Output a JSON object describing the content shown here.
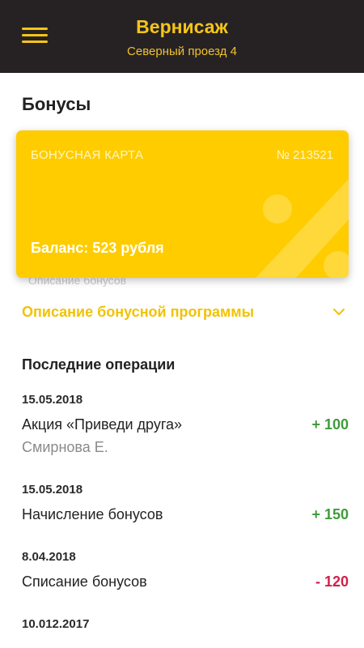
{
  "header": {
    "title": "Вернисаж",
    "subtitle": "Северный проезд 4",
    "icon": "menu-icon",
    "background_color": "#262224",
    "accent_color": "#f5c518"
  },
  "page": {
    "title": "Бонусы"
  },
  "card": {
    "label": "БОНУСНАЯ КАРТА",
    "number": "№ 213521",
    "balance": "Баланс: 523 рубля",
    "color": "#ffcc00",
    "faded_text": "Описание бонусов"
  },
  "program": {
    "label": "Описание бонусной программы",
    "icon": "chevron-down-icon"
  },
  "operations": {
    "title": "Последние операции",
    "items": [
      {
        "date": "15.05.2018",
        "name": "Акция «Приведи друга»",
        "sub": "Смирнова Е.",
        "amount": "+ 100",
        "type": "positive"
      },
      {
        "date": "15.05.2018",
        "name": "Начисление бонусов",
        "amount": "+ 150",
        "type": "positive"
      },
      {
        "date": "8.04.2018",
        "name": "Списание бонусов",
        "amount": "- 120",
        "type": "negative"
      },
      {
        "date": "10.012.2017"
      }
    ],
    "positive_color": "#3f9c3a",
    "negative_color": "#d21f4a"
  }
}
